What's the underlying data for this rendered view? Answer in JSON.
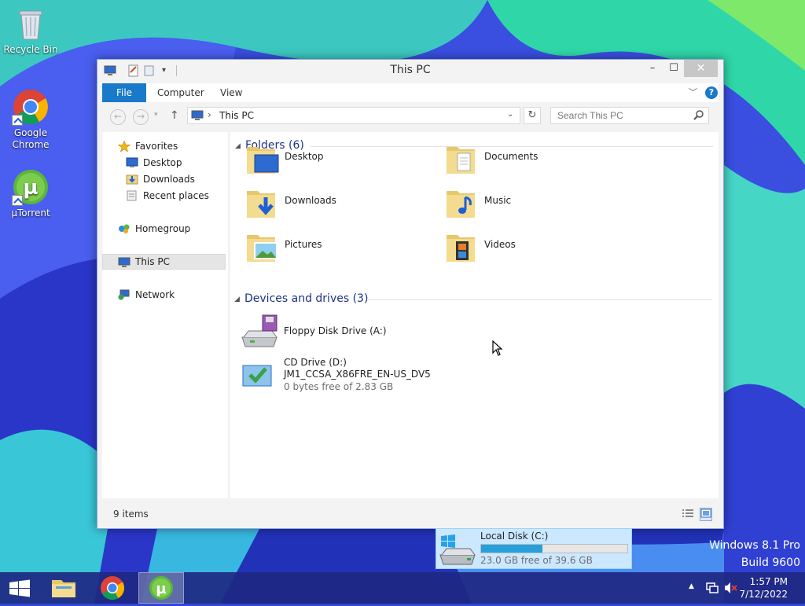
{
  "desktop": {
    "icons": [
      {
        "label": "Recycle Bin"
      },
      {
        "label": "Google Chrome"
      },
      {
        "label": "µTorrent"
      }
    ],
    "watermark": {
      "line1": "Windows 8.1 Pro",
      "line2": "Build 9600"
    }
  },
  "window": {
    "title": "This PC",
    "controls": {
      "minimize": "–",
      "maximize": "☐",
      "close": "✕"
    },
    "ribbon": {
      "tabs": [
        "File",
        "Computer",
        "View"
      ],
      "help": "?"
    },
    "address": {
      "path": "This PC",
      "separator": "›"
    },
    "search": {
      "placeholder": "Search This PC"
    },
    "nav_pane": {
      "favorites": {
        "label": "Favorites",
        "items": [
          "Desktop",
          "Downloads",
          "Recent places"
        ]
      },
      "homegroup": "Homegroup",
      "this_pc": "This PC",
      "network": "Network"
    },
    "folders": {
      "header": "Folders (6)",
      "items": [
        "Desktop",
        "Documents",
        "Downloads",
        "Music",
        "Pictures",
        "Videos"
      ]
    },
    "devices": {
      "header": "Devices and drives (3)",
      "floppy": {
        "name": "Floppy Disk Drive (A:)"
      },
      "local_disk": {
        "name": "Local Disk (C:)",
        "free_text": "23.0 GB free of 39.6 GB",
        "used_fraction": 0.42
      },
      "cd": {
        "name": "CD Drive (D:)",
        "label": "JM1_CCSA_X86FRE_EN-US_DV5",
        "free_text": "0 bytes free of 2.83 GB"
      }
    },
    "status": {
      "count": "9 items"
    }
  },
  "taskbar": {
    "clock": {
      "time": "1:57 PM",
      "date": "7/12/2022"
    }
  },
  "colors": {
    "accent": "#1979ca",
    "selection": "#cce8ff",
    "bar_fill": "#26a0da",
    "taskbar": "#1e2882"
  }
}
